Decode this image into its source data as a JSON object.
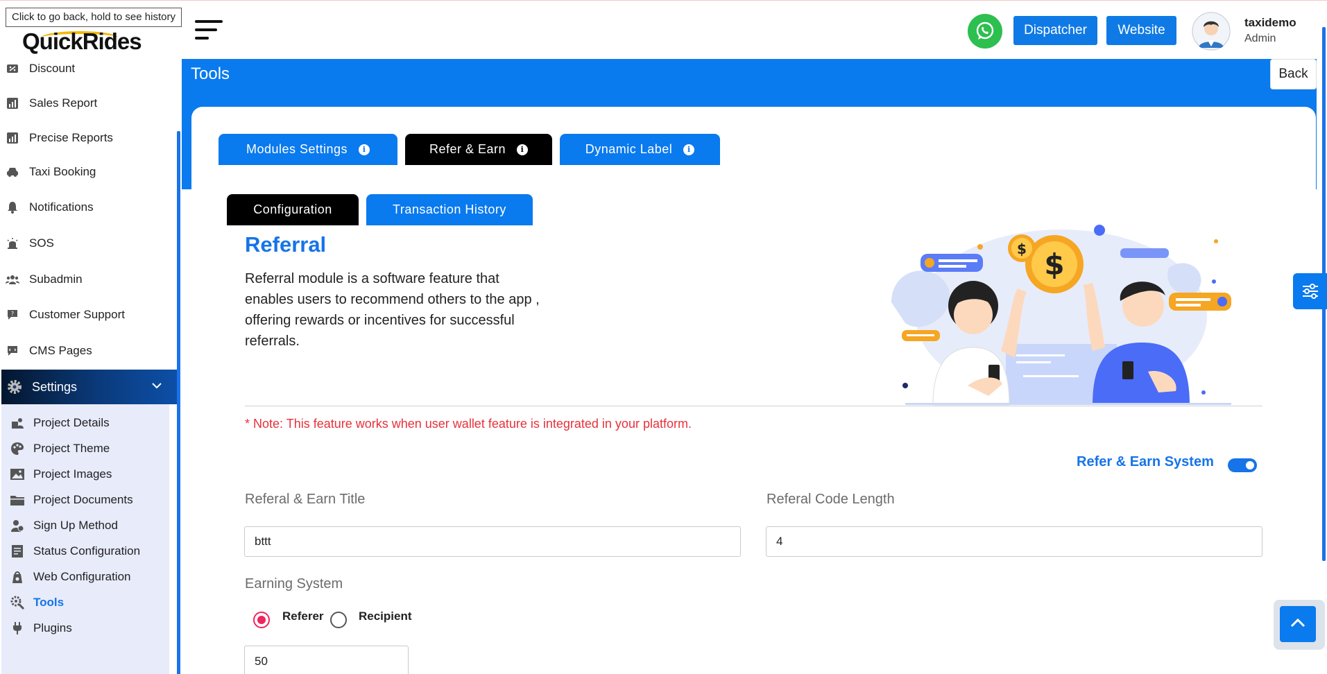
{
  "browser": {
    "tooltip": "Click to go back, hold to see history"
  },
  "brand": {
    "logo_text": "QuickRides"
  },
  "sidebar": {
    "items": [
      {
        "label": "Discount",
        "icon": "discount-icon"
      },
      {
        "label": "Sales Report",
        "icon": "chart-icon"
      },
      {
        "label": "Precise Reports",
        "icon": "chart-icon"
      },
      {
        "label": "Taxi Booking",
        "icon": "car-icon"
      },
      {
        "label": "Notifications",
        "icon": "bell-icon"
      },
      {
        "label": "SOS",
        "icon": "siren-icon"
      },
      {
        "label": "Subadmin",
        "icon": "users-icon"
      },
      {
        "label": "Customer Support",
        "icon": "support-icon"
      },
      {
        "label": "CMS Pages",
        "icon": "cms-icon"
      }
    ],
    "settings": {
      "label": "Settings",
      "icon": "gear-icon"
    },
    "submenu": [
      {
        "label": "Project Details",
        "icon": "project-icon"
      },
      {
        "label": "Project Theme",
        "icon": "palette-icon"
      },
      {
        "label": "Project Images",
        "icon": "image-icon"
      },
      {
        "label": "Project Documents",
        "icon": "folder-icon"
      },
      {
        "label": "Sign Up Method",
        "icon": "user-add-icon"
      },
      {
        "label": "Status Configuration",
        "icon": "status-icon"
      },
      {
        "label": "Web Configuration",
        "icon": "web-config-icon"
      },
      {
        "label": "Tools",
        "icon": "tools-icon",
        "active": true
      },
      {
        "label": "Plugins",
        "icon": "plug-icon"
      }
    ]
  },
  "header": {
    "dispatcher_label": "Dispatcher",
    "website_label": "Website",
    "user_name": "taxidemo",
    "user_role": "Admin"
  },
  "page": {
    "title": "Tools",
    "back_label": "Back"
  },
  "tabs": [
    {
      "label": "Modules Settings",
      "active": false
    },
    {
      "label": "Refer & Earn",
      "active": true
    },
    {
      "label": "Dynamic Label",
      "active": false
    }
  ],
  "subtabs": [
    {
      "label": "Configuration",
      "active": true
    },
    {
      "label": "Transaction History",
      "active": false
    }
  ],
  "referral": {
    "title": "Referral",
    "description": "Referral module is a software feature that enables users to recommend others to the app , offering rewards or incentives for successful referrals.",
    "note": "* Note: This feature works when user wallet feature is integrated in your platform.",
    "toggle_label": "Refer & Earn System",
    "toggle_on": true
  },
  "form": {
    "title_label": "Referal & Earn Title",
    "title_value": "bttt",
    "code_length_label": "Referal Code Length",
    "code_length_value": "4",
    "earning_label": "Earning System",
    "radio_referer": "Referer",
    "radio_recipient": "Recipient",
    "selected": "Referer",
    "amount_value": "50"
  },
  "colors": {
    "primary": "#0a7aef",
    "dark": "#000000",
    "note": "#e8303a",
    "radio": "#f0245e"
  }
}
